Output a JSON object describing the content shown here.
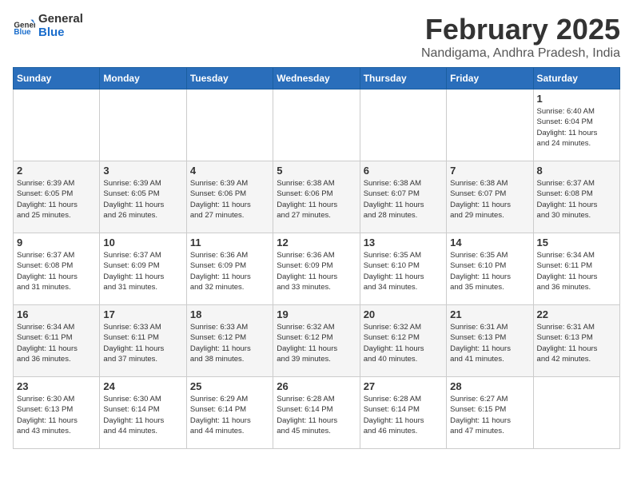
{
  "header": {
    "logo_general": "General",
    "logo_blue": "Blue",
    "month_year": "February 2025",
    "location": "Nandigama, Andhra Pradesh, India"
  },
  "days_of_week": [
    "Sunday",
    "Monday",
    "Tuesday",
    "Wednesday",
    "Thursday",
    "Friday",
    "Saturday"
  ],
  "weeks": [
    [
      {
        "day": "",
        "info": ""
      },
      {
        "day": "",
        "info": ""
      },
      {
        "day": "",
        "info": ""
      },
      {
        "day": "",
        "info": ""
      },
      {
        "day": "",
        "info": ""
      },
      {
        "day": "",
        "info": ""
      },
      {
        "day": "1",
        "info": "Sunrise: 6:40 AM\nSunset: 6:04 PM\nDaylight: 11 hours\nand 24 minutes."
      }
    ],
    [
      {
        "day": "2",
        "info": "Sunrise: 6:39 AM\nSunset: 6:05 PM\nDaylight: 11 hours\nand 25 minutes."
      },
      {
        "day": "3",
        "info": "Sunrise: 6:39 AM\nSunset: 6:05 PM\nDaylight: 11 hours\nand 26 minutes."
      },
      {
        "day": "4",
        "info": "Sunrise: 6:39 AM\nSunset: 6:06 PM\nDaylight: 11 hours\nand 27 minutes."
      },
      {
        "day": "5",
        "info": "Sunrise: 6:38 AM\nSunset: 6:06 PM\nDaylight: 11 hours\nand 27 minutes."
      },
      {
        "day": "6",
        "info": "Sunrise: 6:38 AM\nSunset: 6:07 PM\nDaylight: 11 hours\nand 28 minutes."
      },
      {
        "day": "7",
        "info": "Sunrise: 6:38 AM\nSunset: 6:07 PM\nDaylight: 11 hours\nand 29 minutes."
      },
      {
        "day": "8",
        "info": "Sunrise: 6:37 AM\nSunset: 6:08 PM\nDaylight: 11 hours\nand 30 minutes."
      }
    ],
    [
      {
        "day": "9",
        "info": "Sunrise: 6:37 AM\nSunset: 6:08 PM\nDaylight: 11 hours\nand 31 minutes."
      },
      {
        "day": "10",
        "info": "Sunrise: 6:37 AM\nSunset: 6:09 PM\nDaylight: 11 hours\nand 31 minutes."
      },
      {
        "day": "11",
        "info": "Sunrise: 6:36 AM\nSunset: 6:09 PM\nDaylight: 11 hours\nand 32 minutes."
      },
      {
        "day": "12",
        "info": "Sunrise: 6:36 AM\nSunset: 6:09 PM\nDaylight: 11 hours\nand 33 minutes."
      },
      {
        "day": "13",
        "info": "Sunrise: 6:35 AM\nSunset: 6:10 PM\nDaylight: 11 hours\nand 34 minutes."
      },
      {
        "day": "14",
        "info": "Sunrise: 6:35 AM\nSunset: 6:10 PM\nDaylight: 11 hours\nand 35 minutes."
      },
      {
        "day": "15",
        "info": "Sunrise: 6:34 AM\nSunset: 6:11 PM\nDaylight: 11 hours\nand 36 minutes."
      }
    ],
    [
      {
        "day": "16",
        "info": "Sunrise: 6:34 AM\nSunset: 6:11 PM\nDaylight: 11 hours\nand 36 minutes."
      },
      {
        "day": "17",
        "info": "Sunrise: 6:33 AM\nSunset: 6:11 PM\nDaylight: 11 hours\nand 37 minutes."
      },
      {
        "day": "18",
        "info": "Sunrise: 6:33 AM\nSunset: 6:12 PM\nDaylight: 11 hours\nand 38 minutes."
      },
      {
        "day": "19",
        "info": "Sunrise: 6:32 AM\nSunset: 6:12 PM\nDaylight: 11 hours\nand 39 minutes."
      },
      {
        "day": "20",
        "info": "Sunrise: 6:32 AM\nSunset: 6:12 PM\nDaylight: 11 hours\nand 40 minutes."
      },
      {
        "day": "21",
        "info": "Sunrise: 6:31 AM\nSunset: 6:13 PM\nDaylight: 11 hours\nand 41 minutes."
      },
      {
        "day": "22",
        "info": "Sunrise: 6:31 AM\nSunset: 6:13 PM\nDaylight: 11 hours\nand 42 minutes."
      }
    ],
    [
      {
        "day": "23",
        "info": "Sunrise: 6:30 AM\nSunset: 6:13 PM\nDaylight: 11 hours\nand 43 minutes."
      },
      {
        "day": "24",
        "info": "Sunrise: 6:30 AM\nSunset: 6:14 PM\nDaylight: 11 hours\nand 44 minutes."
      },
      {
        "day": "25",
        "info": "Sunrise: 6:29 AM\nSunset: 6:14 PM\nDaylight: 11 hours\nand 44 minutes."
      },
      {
        "day": "26",
        "info": "Sunrise: 6:28 AM\nSunset: 6:14 PM\nDaylight: 11 hours\nand 45 minutes."
      },
      {
        "day": "27",
        "info": "Sunrise: 6:28 AM\nSunset: 6:14 PM\nDaylight: 11 hours\nand 46 minutes."
      },
      {
        "day": "28",
        "info": "Sunrise: 6:27 AM\nSunset: 6:15 PM\nDaylight: 11 hours\nand 47 minutes."
      },
      {
        "day": "",
        "info": ""
      }
    ]
  ]
}
